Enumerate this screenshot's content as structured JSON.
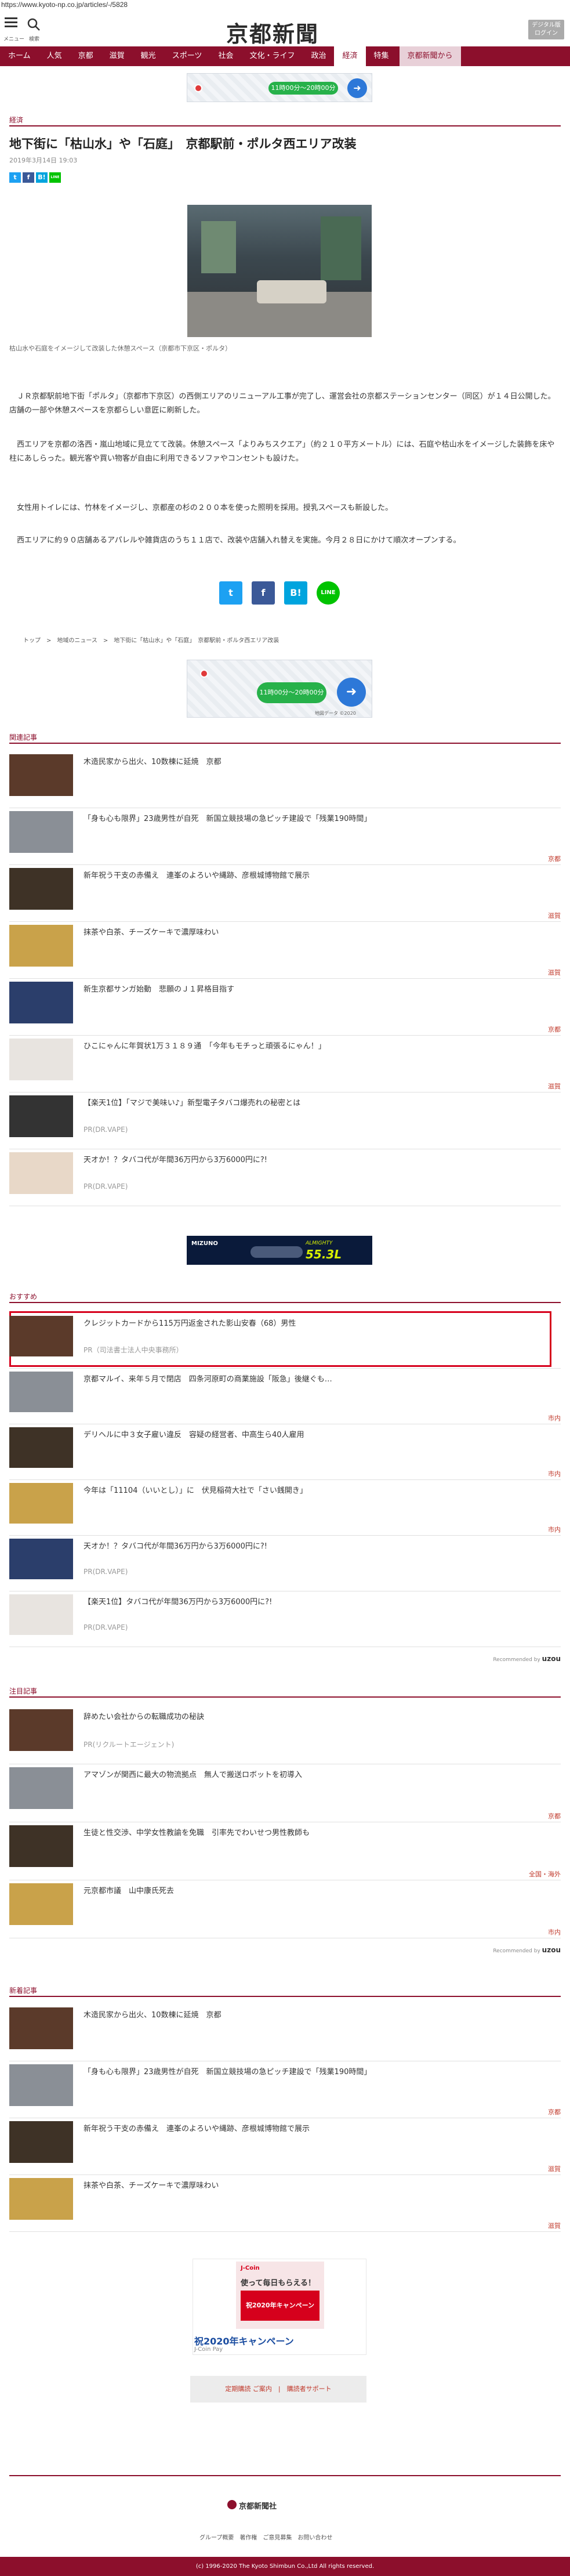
{
  "browser": {
    "url": "https://www.kyoto-np.co.jp/articles/-/5828"
  },
  "header": {
    "menu_label": "メニュー",
    "search_label": "検索",
    "logo": "京都新聞",
    "digital_button": "デジタル版 ログイン"
  },
  "nav": {
    "items": [
      "ホーム",
      "人気",
      "京都",
      "滋賀",
      "観光",
      "スポーツ",
      "社会",
      "文化・ライフ",
      "政治",
      "経済",
      "特集",
      "京都新聞から"
    ],
    "active_index": 9
  },
  "ad_top": {
    "button": "11時00分〜20時00分"
  },
  "article": {
    "category": "経済",
    "title": "地下街に「枯山水」や「石庭」　京都駅前・ポルタ西エリア改装",
    "date": "2019年3月14日 19:03",
    "share_small": [
      "t",
      "f",
      "B!",
      "LINE"
    ],
    "photo_caption": "枯山水や石庭をイメージして改装した休憩スペース（京都市下京区・ポルタ）",
    "paragraphs": [
      "　ＪＲ京都駅前地下街「ポルタ」（京都市下京区）の西側エリアのリニューアル工事が完了し、運営会社の京都ステーションセンター（同区）が１４日公開した。店舗の一部や休憩スペースを京都らしい意匠に刷新した。",
      "　西エリアを京都の洛西・嵐山地域に見立てて改装。休憩スペース「よりみちスクエア」（約２１０平方メートル）には、石庭や枯山水をイメージした装飾を床や柱にあしらった。観光客や買い物客が自由に利用できるソファやコンセントも設けた。",
      "　女性用トイレには、竹林をイメージし、京都産の杉の２００本を使った照明を採用。授乳スペースも新設した。",
      "　西エリアに約９０店舗あるアパレルや雑貨店のうち１１店で、改装や店舗入れ替えを実施。今月２８日にかけて順次オープンする。"
    ],
    "share_big": [
      "t",
      "f",
      "B!",
      "LINE"
    ],
    "breadcrumbs": "トップ　>　地域のニュース　>　地下街に「枯山水」や「石庭」　京都駅前・ポルタ西エリア改装"
  },
  "ad_mid": {
    "button": "11時00分〜20時00分",
    "map_text": "地図データ ©2020"
  },
  "related": {
    "label": "関連記事",
    "items": [
      {
        "text": "木造民家から出火、10数棟に延焼　京都",
        "sub": "",
        "tag": ""
      },
      {
        "text": "「身も心も限界」23歳男性が自死　新国立競技場の急ピッチ建設で「残業190時間」",
        "sub": "",
        "tag": "京都"
      },
      {
        "text": "新年祝う干支の赤備え　連峯のよろいや縄跡、彦根城博物館で展示",
        "sub": "",
        "tag": "滋賀"
      },
      {
        "text": "抹茶や白茶、チーズケーキで濃厚味わい",
        "sub": "",
        "tag": "滋賀"
      },
      {
        "text": "新生京都サンガ始動　悲願のＪ１昇格目指す",
        "sub": "",
        "tag": "京都"
      },
      {
        "text": "ひこにゃんに年賀状1万３１８９通　「今年もモチっと頑張るにゃん！」",
        "sub": "",
        "tag": "滋賀"
      },
      {
        "text": "【楽天1位】「マジで美味い♪」新型電子タバコ爆売れの秘密とは",
        "sub": "PR(DR.VAPE)",
        "tag": ""
      },
      {
        "text": "天オか！？タバコ代が年間36万円から3万6000円に?!",
        "sub": "PR(DR.VAPE)",
        "tag": ""
      }
    ]
  },
  "ad_mizuno": {
    "brand": "MIZUNO",
    "product": "ALMIGHTY",
    "price": "55.3L"
  },
  "recommend": {
    "label": "おすすめ",
    "items": [
      {
        "text": "クレジットカードから115万円返金された影山安春（68）男性",
        "sub": "PR（司法書士法人中央事務所）",
        "tag": ""
      },
      {
        "text": "京都マルイ、来年５月で閉店　四条河原町の商業施設「阪急」後継ぐも…",
        "sub": "",
        "tag": "市内"
      },
      {
        "text": "デリヘルに中３女子雇い違反　容疑の経営者、中高生ら40人雇用",
        "sub": "",
        "tag": "市内"
      },
      {
        "text": "今年は「11104（いいとし）」に　伏見稲荷大社で「さい銭開き」",
        "sub": "",
        "tag": "市内"
      },
      {
        "text": "天オか！？タバコ代が年間36万円から3万6000円に?!",
        "sub": "PR(DR.VAPE)",
        "tag": ""
      },
      {
        "text": "【楽天1位】タバコ代が年間36万円から3万6000円に?!",
        "sub": "PR(DR.VAPE)",
        "tag": ""
      }
    ],
    "powered": "Recommended by",
    "powered_brand": "uzou"
  },
  "featured": {
    "label": "注目記事",
    "items": [
      {
        "text": "辞めたい会社からの転職成功の秘訣",
        "sub": "PR(リクルートエージェント)",
        "tag": ""
      },
      {
        "text": "アマゾンが関西に最大の物流拠点　無人で搬送ロボットを初導入",
        "sub": "",
        "tag": "京都"
      },
      {
        "text": "生徒と性交渉、中学女性教諭を免職　引率先でわいせつ男性教師も",
        "sub": "",
        "tag": "全国・海外"
      },
      {
        "text": "元京都市議　山中康氏死去",
        "sub": "",
        "tag": "市内"
      }
    ],
    "powered": "Recommended by",
    "powered_brand": "uzou"
  },
  "latest": {
    "label": "新着記事",
    "items": [
      {
        "text": "木造民家から出火、10数棟に延焼　京都",
        "sub": "",
        "tag": ""
      },
      {
        "text": "「身も心も限界」23歳男性が自死　新国立競技場の急ピッチ建設で「残業190時間」",
        "sub": "",
        "tag": "京都"
      },
      {
        "text": "新年祝う干支の赤備え　連峯のよろいや縄跡、彦根城博物館で展示",
        "sub": "",
        "tag": "滋賀"
      },
      {
        "text": "抹茶や白茶、チーズケーキで濃厚味わい",
        "sub": "",
        "tag": "滋賀"
      }
    ]
  },
  "ad_bottom": {
    "brand": "J-Coin",
    "line1": "使って毎日もらえる！",
    "line2": "祝2020年キャンペーン",
    "headline": "祝2020年キャンペーン",
    "advertiser": "J-Coin Pay"
  },
  "bottom_links": "定期購読 ご案内　|　購読者サポート",
  "footer": {
    "logo": "京都新聞社",
    "links": "グループ概要　著作権　ご意見募集　お問い合わせ",
    "copyright": "(c) 1996-2020 The Kyoto Shimbun Co.,Ltd All rights reserved."
  },
  "colors": {
    "brand": "#8c0f2c",
    "twitter": "#1da1f2",
    "facebook": "#3b5998",
    "hatena": "#00a4de",
    "line": "#00c300",
    "tag": "#c0392b"
  }
}
